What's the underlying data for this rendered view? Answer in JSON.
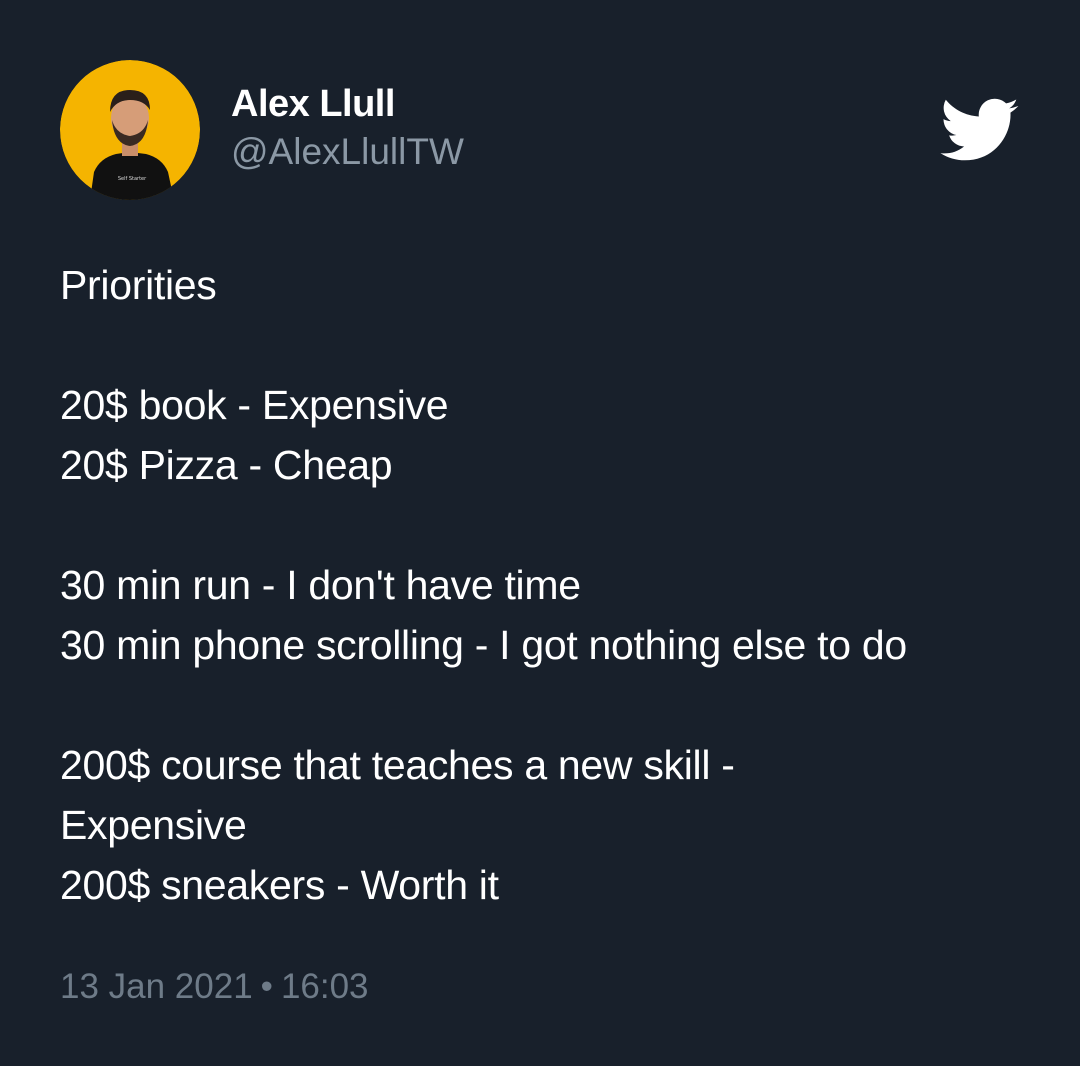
{
  "tweet": {
    "author": {
      "display_name": "Alex Llull",
      "handle": "@AlexLlullTW",
      "avatar_icon": "profile-photo",
      "avatar_bg": "#f5b400",
      "shirt_text": "Self Starter"
    },
    "platform_icon": "twitter-bird-icon",
    "lines": [
      "Priorities",
      "",
      "20$ book - Expensive",
      "20$ Pizza - Cheap",
      "",
      "30 min run - I don't have time",
      "30 min phone scrolling - I got nothing else to do",
      "",
      "200$ course that teaches a new skill -",
      "Expensive",
      "200$ sneakers - Worth it"
    ],
    "date": "13 Jan 2021",
    "separator": "•",
    "time": "16:03"
  },
  "colors": {
    "background": "#18202b",
    "text": "#ffffff",
    "secondary": "#8b98a5",
    "timestamp": "#6e7b88"
  }
}
